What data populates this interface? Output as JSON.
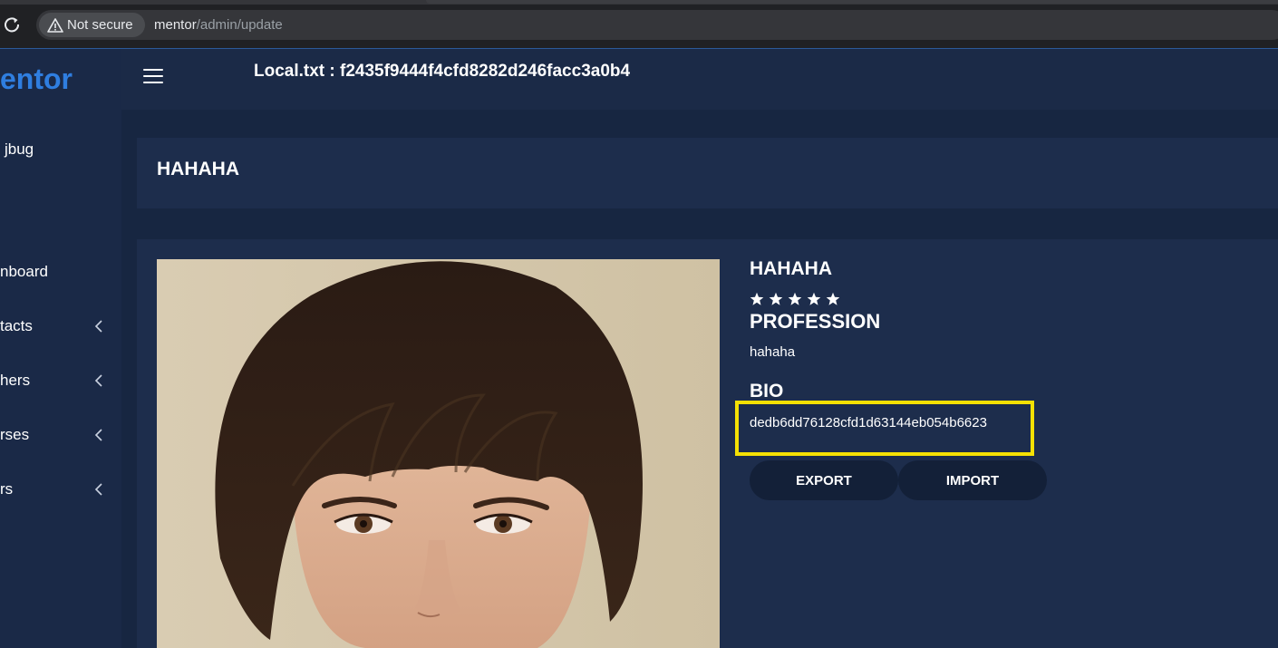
{
  "browser": {
    "security_label": "Not secure",
    "url_host": "mentor",
    "url_path": "/admin/update"
  },
  "app": {
    "brand": "entor",
    "user_name": "jbug",
    "local_txt": "Local.txt : f2435f9444f4cfd8282d246facc3a0b4"
  },
  "sidebar": {
    "items": [
      {
        "label": "nboard",
        "has_chevron": false
      },
      {
        "label": "tacts",
        "has_chevron": true
      },
      {
        "label": "hers",
        "has_chevron": true
      },
      {
        "label": "rses",
        "has_chevron": true
      },
      {
        "label": "rs",
        "has_chevron": true
      }
    ]
  },
  "page": {
    "title": "HAHAHA"
  },
  "profile": {
    "name": "HAHAHA",
    "rating": 5,
    "profession_heading": "PROFESSION",
    "profession": "hahaha",
    "bio_heading": "BIO",
    "bio": "dedb6dd76128cfd1d63144eb054b6623",
    "export_label": "EXPORT",
    "import_label": "IMPORT",
    "highlight_color": "#f5e104"
  },
  "colors": {
    "brand": "#2f7ee0",
    "background": "#1b2a47"
  }
}
